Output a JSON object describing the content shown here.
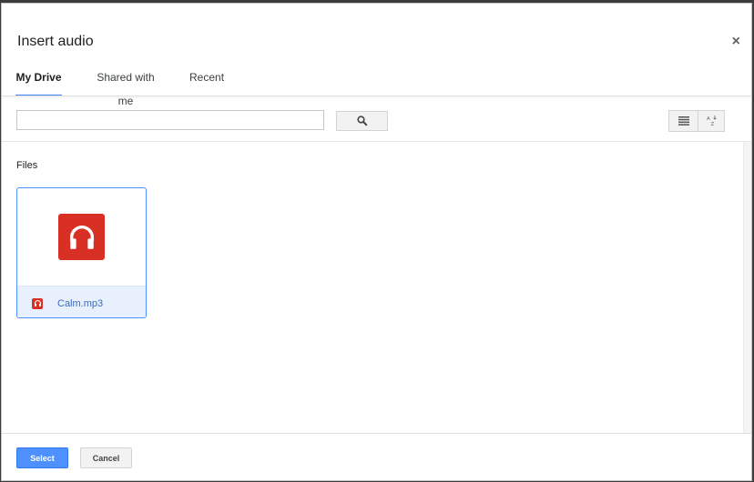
{
  "dialog": {
    "title": "Insert audio",
    "close_glyph": "×"
  },
  "tabs": [
    {
      "label": "My Drive",
      "active": true
    },
    {
      "label": "Shared with me",
      "active": false
    },
    {
      "label": "Recent",
      "active": false
    }
  ],
  "search": {
    "value": "",
    "placeholder": "",
    "button_icon": "search-icon"
  },
  "view": {
    "list_icon": "list-view-icon",
    "sort_icon": "sort-az-icon"
  },
  "content": {
    "section_label": "Files",
    "files": [
      {
        "name": "Calm.mp3",
        "icon": "headphones-icon",
        "selected": true
      }
    ]
  },
  "footer": {
    "select_label": "Select",
    "cancel_label": "Cancel"
  },
  "colors": {
    "accent": "#4d90fe",
    "audio_red": "#d93025",
    "selected_bg": "#e8f0fe"
  }
}
